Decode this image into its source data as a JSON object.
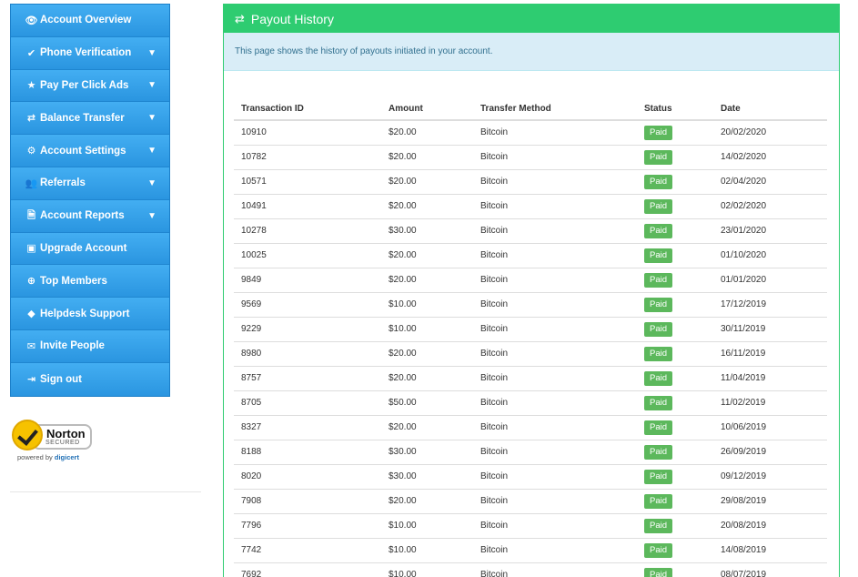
{
  "sidebar": {
    "items": [
      {
        "label": "Account Overview",
        "icon": "eye-icon",
        "glyph": "👁",
        "chevron": false
      },
      {
        "label": "Phone Verification",
        "icon": "check-icon",
        "glyph": "✔",
        "chevron": true
      },
      {
        "label": "Pay Per Click Ads",
        "icon": "star-icon",
        "glyph": "★",
        "chevron": true
      },
      {
        "label": "Balance Transfer",
        "icon": "exchange-icon",
        "glyph": "⇄",
        "chevron": true
      },
      {
        "label": "Account Settings",
        "icon": "gear-icon",
        "glyph": "⚙",
        "chevron": true
      },
      {
        "label": "Referrals",
        "icon": "users-icon",
        "glyph": "👥",
        "chevron": true
      },
      {
        "label": "Account Reports",
        "icon": "file-icon",
        "glyph": "🗎",
        "chevron": true
      },
      {
        "label": "Upgrade Account",
        "icon": "money-icon",
        "glyph": "▣",
        "chevron": false
      },
      {
        "label": "Top Members",
        "icon": "upload-circle-icon",
        "glyph": "⊕",
        "chevron": false
      },
      {
        "label": "Helpdesk Support",
        "icon": "tag-icon",
        "glyph": "◆",
        "chevron": false
      },
      {
        "label": "Invite People",
        "icon": "envelope-icon",
        "glyph": "✉",
        "chevron": false
      },
      {
        "label": "Sign out",
        "icon": "sign-out-icon",
        "glyph": "⇥",
        "chevron": false
      }
    ]
  },
  "norton": {
    "brand": "Norton",
    "secured": "SECURED",
    "powered_by": "powered by",
    "digicert": "digicert"
  },
  "panel": {
    "title": "Payout History",
    "info": "This page shows the history of payouts initiated in your account."
  },
  "table": {
    "headers": [
      "Transaction ID",
      "Amount",
      "Transfer Method",
      "Status",
      "Date"
    ],
    "rows": [
      [
        "10910",
        "$20.00",
        "Bitcoin",
        "Paid",
        "20/02/2020"
      ],
      [
        "10782",
        "$20.00",
        "Bitcoin",
        "Paid",
        "14/02/2020"
      ],
      [
        "10571",
        "$20.00",
        "Bitcoin",
        "Paid",
        "02/04/2020"
      ],
      [
        "10491",
        "$20.00",
        "Bitcoin",
        "Paid",
        "02/02/2020"
      ],
      [
        "10278",
        "$30.00",
        "Bitcoin",
        "Paid",
        "23/01/2020"
      ],
      [
        "10025",
        "$20.00",
        "Bitcoin",
        "Paid",
        "01/10/2020"
      ],
      [
        "9849",
        "$20.00",
        "Bitcoin",
        "Paid",
        "01/01/2020"
      ],
      [
        "9569",
        "$10.00",
        "Bitcoin",
        "Paid",
        "17/12/2019"
      ],
      [
        "9229",
        "$10.00",
        "Bitcoin",
        "Paid",
        "30/11/2019"
      ],
      [
        "8980",
        "$20.00",
        "Bitcoin",
        "Paid",
        "16/11/2019"
      ],
      [
        "8757",
        "$20.00",
        "Bitcoin",
        "Paid",
        "11/04/2019"
      ],
      [
        "8705",
        "$50.00",
        "Bitcoin",
        "Paid",
        "11/02/2019"
      ],
      [
        "8327",
        "$20.00",
        "Bitcoin",
        "Paid",
        "10/06/2019"
      ],
      [
        "8188",
        "$30.00",
        "Bitcoin",
        "Paid",
        "26/09/2019"
      ],
      [
        "8020",
        "$30.00",
        "Bitcoin",
        "Paid",
        "09/12/2019"
      ],
      [
        "7908",
        "$20.00",
        "Bitcoin",
        "Paid",
        "29/08/2019"
      ],
      [
        "7796",
        "$10.00",
        "Bitcoin",
        "Paid",
        "20/08/2019"
      ],
      [
        "7742",
        "$10.00",
        "Bitcoin",
        "Paid",
        "14/08/2019"
      ],
      [
        "7692",
        "$10.00",
        "Bitcoin",
        "Paid",
        "08/07/2019"
      ]
    ]
  },
  "colors": {
    "sidebar": "#2e9ee8",
    "panel_header": "#2ecc71",
    "info_bg": "#d9edf7",
    "badge": "#5cb85c"
  }
}
